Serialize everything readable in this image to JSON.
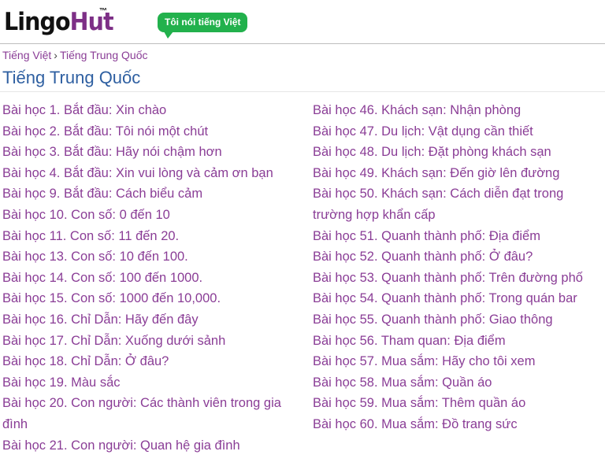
{
  "header": {
    "logo_part1": "Lingo",
    "logo_part2": "Hut",
    "logo_tm": "™",
    "speech_text": "Tôi nói tiếng Việt"
  },
  "breadcrumb": {
    "home": "Tiếng Việt",
    "separator": "›",
    "current": "Tiếng Trung Quốc"
  },
  "page": {
    "title": "Tiếng Trung Quốc"
  },
  "lessons_left": [
    "Bài học 1. Bắt đầu: Xin chào",
    "Bài học 2. Bắt đầu: Tôi nói một chút",
    "Bài học 3. Bắt đầu: Hãy nói chậm hơn",
    "Bài học 4. Bắt đầu: Xin vui lòng và cảm ơn bạn",
    "Bài học 9. Bắt đầu: Cách biểu cảm",
    "Bài học 10. Con số: 0 đến 10",
    "Bài học 11. Con số: 11 đến 20.",
    "Bài học 13. Con số: 10 đến 100.",
    "Bài học 14. Con số: 100 đến 1000.",
    "Bài học 15. Con số: 1000 đến 10,000.",
    "Bài học 16. Chỉ Dẫn: Hãy đến đây",
    "Bài học 17. Chỉ Dẫn: Xuống dưới sảnh",
    "Bài học 18. Chỉ Dẫn: Ở đâu?",
    "Bài học 19. Màu sắc",
    "Bài học 20. Con người: Các thành viên trong gia đình",
    "Bài học 21. Con người: Quan hệ gia đình"
  ],
  "lessons_right": [
    "Bài học 46. Khách sạn: Nhận phòng",
    "Bài học 47. Du lịch: Vật dụng cần thiết",
    "Bài học 48. Du lịch: Đặt phòng khách sạn",
    "Bài học 49. Khách sạn: Đến giờ lên đường",
    "Bài học 50. Khách sạn: Cách diễn đạt trong trường hợp khẩn cấp",
    "Bài học 51. Quanh thành phố: Địa điểm",
    "Bài học 52. Quanh thành phố: Ở đâu?",
    "Bài học 53. Quanh thành phố: Trên đường phố",
    "Bài học 54. Quanh thành phố: Trong quán bar",
    "Bài học 55. Quanh thành phố: Giao thông",
    "Bài học 56. Tham quan: Địa điểm",
    "Bài học 57. Mua sắm: Hãy cho tôi xem",
    "Bài học 58. Mua sắm: Quần áo",
    "Bài học 59. Mua sắm: Thêm quần áo",
    "Bài học 60. Mua sắm: Đồ trang sức"
  ]
}
